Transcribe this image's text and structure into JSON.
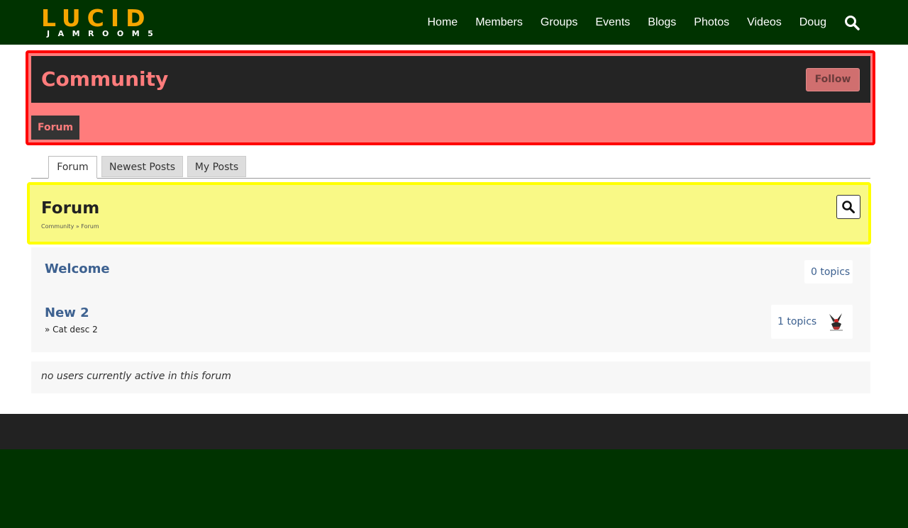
{
  "brand": {
    "logo_main": "LUCID",
    "logo_sub": "JAMROOM5"
  },
  "nav": {
    "items": [
      "Home",
      "Members",
      "Groups",
      "Events",
      "Blogs",
      "Photos",
      "Videos",
      "Doug"
    ],
    "search_icon": "search-icon"
  },
  "profile": {
    "title": "Community",
    "follow_label": "Follow",
    "tab_label": "Forum"
  },
  "tabs": [
    {
      "label": "Forum",
      "active": true
    },
    {
      "label": "Newest Posts",
      "active": false
    },
    {
      "label": "My Posts",
      "active": false
    }
  ],
  "forum": {
    "title": "Forum",
    "breadcrumb": "Community » Forum"
  },
  "categories": [
    {
      "title": "Welcome",
      "description": "",
      "topics": "0 topics"
    },
    {
      "title": "New 2",
      "description": "» Cat desc 2",
      "topics": "1 topics"
    }
  ],
  "active_users": "no users currently active in this forum",
  "colors": {
    "nav_bg": "#003300",
    "logo_accent": "#f5a500",
    "profile_accent": "#ff7c7c",
    "profile_outline": "#ff0000",
    "forum_bg": "#f9f986",
    "forum_outline": "#ffff00",
    "link": "#3d6190",
    "footer": "#222222"
  }
}
